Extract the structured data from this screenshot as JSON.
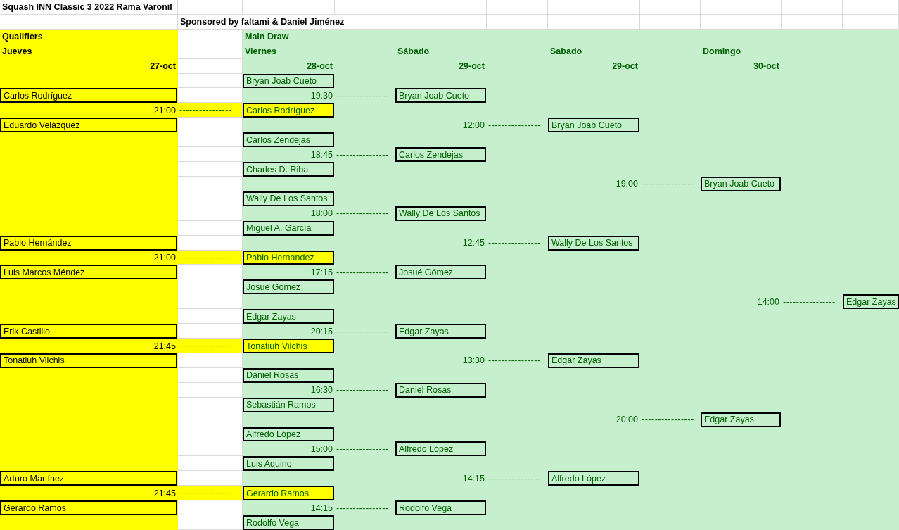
{
  "sheet": {
    "rows": [
      [
        {
          "text": "Squash INN Classic 3 2022 Rama Varonil",
          "kind": "title"
        },
        null,
        null,
        null,
        null,
        null,
        null,
        null,
        null,
        null,
        null
      ],
      [
        null,
        {
          "text": "Sponsored by faltami & Daniel Jiménez",
          "kind": "title"
        },
        null,
        null,
        null,
        null,
        null,
        null,
        null,
        null,
        null
      ],
      [
        {
          "text": "Qualifiers",
          "kind": "header"
        },
        null,
        {
          "text": "Main Draw",
          "kind": "header"
        },
        null,
        null,
        null,
        null,
        null,
        null,
        null,
        null
      ],
      [
        {
          "text": "Jueves",
          "kind": "header"
        },
        null,
        {
          "text": "Viernes",
          "kind": "header"
        },
        null,
        {
          "text": "Sábado",
          "kind": "header"
        },
        null,
        {
          "text": "Sabado",
          "kind": "header"
        },
        null,
        {
          "text": "Domingo",
          "kind": "header"
        },
        null,
        null
      ],
      [
        {
          "text": "27-oct",
          "kind": "date"
        },
        null,
        {
          "text": "28-oct",
          "kind": "date"
        },
        null,
        {
          "text": "29-oct",
          "kind": "date"
        },
        null,
        {
          "text": "29-oct",
          "kind": "date"
        },
        null,
        {
          "text": "30-oct",
          "kind": "date"
        },
        null,
        null
      ],
      [
        null,
        null,
        {
          "text": "Bryan Joab Cueto",
          "kind": "player"
        },
        null,
        null,
        null,
        null,
        null,
        null,
        null,
        null
      ],
      [
        {
          "text": "Carlos Rodríguez",
          "kind": "player"
        },
        null,
        {
          "text": "19:30",
          "kind": "time"
        },
        {
          "text": "----------------",
          "kind": "leader"
        },
        {
          "text": "Bryan Joab Cueto",
          "kind": "player"
        },
        null,
        null,
        null,
        null,
        null,
        null
      ],
      [
        {
          "text": "21:00",
          "kind": "time"
        },
        {
          "text": "----------------",
          "kind": "qualifier-leader"
        },
        {
          "text": "Carlos Rodríguez",
          "kind": "qualifier"
        },
        null,
        null,
        null,
        null,
        null,
        null,
        null,
        null
      ],
      [
        {
          "text": "Eduardo Velázquez",
          "kind": "player"
        },
        null,
        null,
        null,
        {
          "text": "12:00",
          "kind": "time"
        },
        {
          "text": "----------------",
          "kind": "leader"
        },
        {
          "text": "Bryan Joab Cueto",
          "kind": "player"
        },
        null,
        null,
        null,
        null
      ],
      [
        null,
        null,
        {
          "text": "Carlos Zendejas",
          "kind": "player"
        },
        null,
        null,
        null,
        null,
        null,
        null,
        null,
        null
      ],
      [
        null,
        null,
        {
          "text": "18:45",
          "kind": "time"
        },
        {
          "text": "----------------",
          "kind": "leader"
        },
        {
          "text": "Carlos Zendejas",
          "kind": "player"
        },
        null,
        null,
        null,
        null,
        null,
        null
      ],
      [
        null,
        null,
        {
          "text": "Charles D. Riba",
          "kind": "player"
        },
        null,
        null,
        null,
        null,
        null,
        null,
        null,
        null
      ],
      [
        null,
        null,
        null,
        null,
        null,
        null,
        {
          "text": "19:00",
          "kind": "time"
        },
        {
          "text": "----------------",
          "kind": "leader"
        },
        {
          "text": "Bryan Joab Cueto",
          "kind": "player"
        },
        null,
        null
      ],
      [
        null,
        null,
        {
          "text": "Wally De Los Santos",
          "kind": "player"
        },
        null,
        null,
        null,
        null,
        null,
        null,
        null,
        null
      ],
      [
        null,
        null,
        {
          "text": "18:00",
          "kind": "time"
        },
        {
          "text": "----------------",
          "kind": "leader"
        },
        {
          "text": "Wally De Los Santos",
          "kind": "player"
        },
        null,
        null,
        null,
        null,
        null,
        null
      ],
      [
        null,
        null,
        {
          "text": "Miguel A. García",
          "kind": "player"
        },
        null,
        null,
        null,
        null,
        null,
        null,
        null,
        null
      ],
      [
        {
          "text": "Pablo Hernández",
          "kind": "player"
        },
        null,
        null,
        null,
        {
          "text": "12:45",
          "kind": "time"
        },
        {
          "text": "----------------",
          "kind": "leader"
        },
        {
          "text": "Wally De Los Santos",
          "kind": "player"
        },
        null,
        null,
        null,
        null
      ],
      [
        {
          "text": "21:00",
          "kind": "time"
        },
        {
          "text": "----------------",
          "kind": "qualifier-leader"
        },
        {
          "text": "Pablo Hernandez",
          "kind": "qualifier"
        },
        null,
        null,
        null,
        null,
        null,
        null,
        null,
        null
      ],
      [
        {
          "text": "Luis Marcos Méndez",
          "kind": "player"
        },
        null,
        {
          "text": "17:15",
          "kind": "time"
        },
        {
          "text": "----------------",
          "kind": "leader"
        },
        {
          "text": "Josué Gómez",
          "kind": "player"
        },
        null,
        null,
        null,
        null,
        null,
        null
      ],
      [
        null,
        null,
        {
          "text": "Josué Gómez",
          "kind": "player"
        },
        null,
        null,
        null,
        null,
        null,
        null,
        null,
        null
      ],
      [
        null,
        null,
        null,
        null,
        null,
        null,
        null,
        null,
        {
          "text": "14:00",
          "kind": "time"
        },
        {
          "text": "----------------",
          "kind": "leader"
        },
        {
          "text": "Edgar Zayas",
          "kind": "player"
        }
      ],
      [
        null,
        null,
        {
          "text": "Edgar Zayas",
          "kind": "player"
        },
        null,
        null,
        null,
        null,
        null,
        null,
        null,
        null
      ],
      [
        {
          "text": "Erik Castillo",
          "kind": "player"
        },
        null,
        {
          "text": "20:15",
          "kind": "time"
        },
        {
          "text": "----------------",
          "kind": "leader"
        },
        {
          "text": "Edgar Zayas",
          "kind": "player"
        },
        null,
        null,
        null,
        null,
        null,
        null
      ],
      [
        {
          "text": "21:45",
          "kind": "time"
        },
        {
          "text": "----------------",
          "kind": "qualifier-leader"
        },
        {
          "text": "Tonatiuh Vilchis",
          "kind": "qualifier"
        },
        null,
        null,
        null,
        null,
        null,
        null,
        null,
        null
      ],
      [
        {
          "text": "Tonatiuh Vilchis",
          "kind": "player"
        },
        null,
        null,
        null,
        {
          "text": "13:30",
          "kind": "time"
        },
        {
          "text": "----------------",
          "kind": "leader"
        },
        {
          "text": "Edgar Zayas",
          "kind": "player"
        },
        null,
        null,
        null,
        null
      ],
      [
        null,
        null,
        {
          "text": "Daniel Rosas",
          "kind": "player"
        },
        null,
        null,
        null,
        null,
        null,
        null,
        null,
        null
      ],
      [
        null,
        null,
        {
          "text": "16:30",
          "kind": "time"
        },
        {
          "text": "----------------",
          "kind": "leader"
        },
        {
          "text": "Daniel Rosas",
          "kind": "player"
        },
        null,
        null,
        null,
        null,
        null,
        null
      ],
      [
        null,
        null,
        {
          "text": "Sebastián Ramos",
          "kind": "player"
        },
        null,
        null,
        null,
        null,
        null,
        null,
        null,
        null
      ],
      [
        null,
        null,
        null,
        null,
        null,
        null,
        {
          "text": "20:00",
          "kind": "time"
        },
        {
          "text": "----------------",
          "kind": "leader"
        },
        {
          "text": "Edgar Zayas",
          "kind": "player"
        },
        null,
        null
      ],
      [
        null,
        null,
        {
          "text": "Alfredo López",
          "kind": "player"
        },
        null,
        null,
        null,
        null,
        null,
        null,
        null,
        null
      ],
      [
        null,
        null,
        {
          "text": "15:00",
          "kind": "time"
        },
        {
          "text": "----------------",
          "kind": "leader"
        },
        {
          "text": "Alfredo López",
          "kind": "player"
        },
        null,
        null,
        null,
        null,
        null,
        null
      ],
      [
        null,
        null,
        {
          "text": "Luis Aquino",
          "kind": "player"
        },
        null,
        null,
        null,
        null,
        null,
        null,
        null,
        null
      ],
      [
        {
          "text": "Arturo Martínez",
          "kind": "player"
        },
        null,
        null,
        null,
        {
          "text": "14:15",
          "kind": "time"
        },
        {
          "text": "----------------",
          "kind": "leader"
        },
        {
          "text": "Alfredo López",
          "kind": "player"
        },
        null,
        null,
        null,
        null
      ],
      [
        {
          "text": "21:45",
          "kind": "time"
        },
        {
          "text": "----------------",
          "kind": "qualifier-leader"
        },
        {
          "text": "Gerardo Ramos",
          "kind": "qualifier"
        },
        null,
        null,
        null,
        null,
        null,
        null,
        null,
        null
      ],
      [
        {
          "text": "Gerardo Ramos",
          "kind": "player"
        },
        null,
        {
          "text": "14:15",
          "kind": "time"
        },
        {
          "text": "----------------",
          "kind": "leader"
        },
        {
          "text": "Rodolfo Vega",
          "kind": "player"
        },
        null,
        null,
        null,
        null,
        null,
        null
      ],
      [
        null,
        null,
        {
          "text": "Rodolfo Vega",
          "kind": "player"
        },
        null,
        null,
        null,
        null,
        null,
        null,
        null,
        null
      ]
    ]
  }
}
